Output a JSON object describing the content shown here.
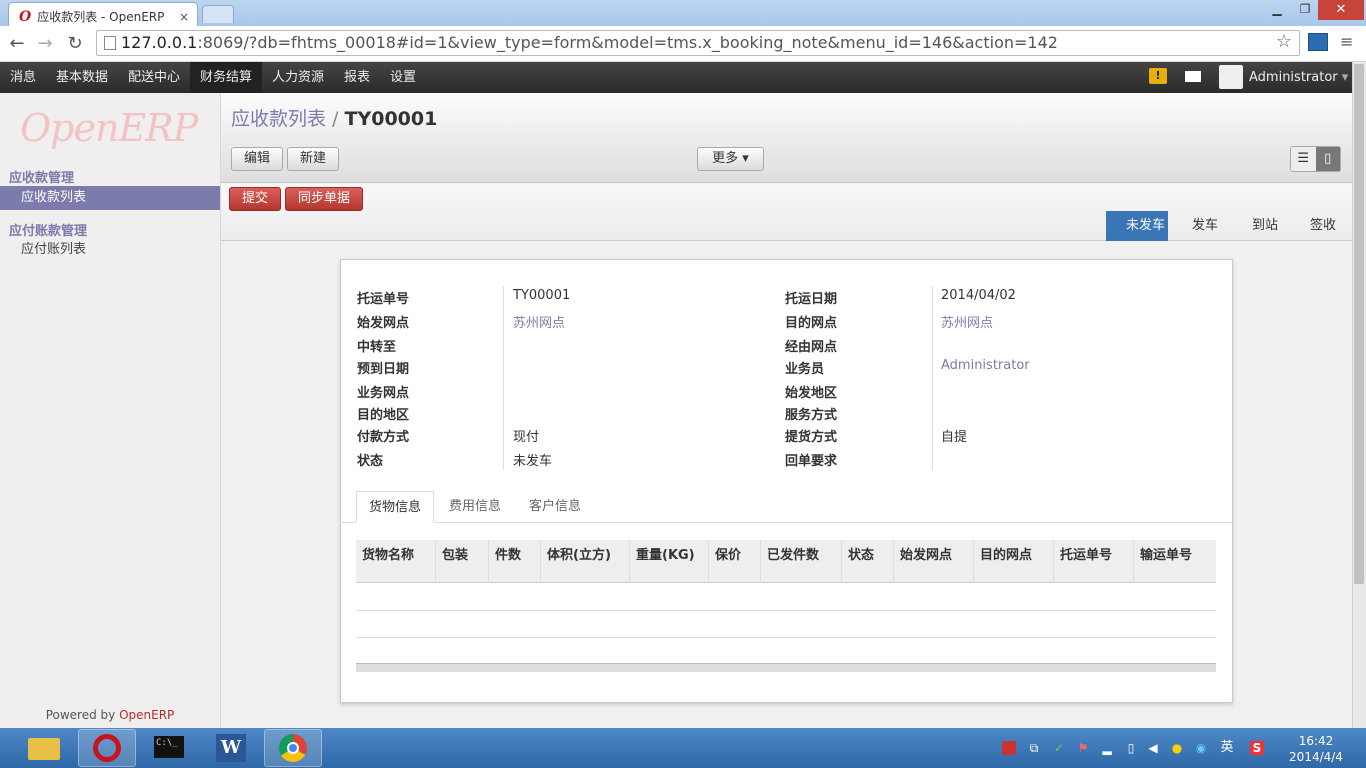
{
  "browser": {
    "tab_title": "应收款列表 - OpenERP",
    "tab_close": "×",
    "url_host": "127.0.0.1",
    "url_rest": ":8069/?db=fhtms_00018#id=1&view_type=form&model=tms.x_booking_note&menu_id=146&action=142",
    "min": "▁",
    "max": "❐",
    "close": "✕"
  },
  "topmenu": [
    "消息",
    "基本数据",
    "配送中心",
    "财务结算",
    "人力资源",
    "报表",
    "设置"
  ],
  "active_menu": "财务结算",
  "user": {
    "name": "Administrator",
    "caret": "▾",
    "warn": "!"
  },
  "sidebar": {
    "logo": "OpenERP",
    "sections": [
      {
        "title": "应收款管理",
        "items": [
          "应收款列表"
        ]
      },
      {
        "title": "应付账款管理",
        "items": [
          "应付账列表"
        ]
      }
    ],
    "powered_prefix": "Powered by ",
    "powered_brand": "OpenERP"
  },
  "breadcrumb": {
    "parent": "应收款列表",
    "sep": " / ",
    "current": "TY00001"
  },
  "buttons": {
    "edit": "编辑",
    "create": "新建",
    "more": "更多 ▾",
    "submit": "提交",
    "sync": "同步单据"
  },
  "view_switch": {
    "list": "☰",
    "form": "▯"
  },
  "stages": [
    "未发车",
    "发车",
    "到站",
    "签收"
  ],
  "active_stage": "未发车",
  "form": {
    "left": [
      {
        "label": "托运单号",
        "value": "TY00001"
      },
      {
        "label": "始发网点",
        "value": "苏州网点",
        "link": true
      },
      {
        "label": "中转至",
        "value": ""
      },
      {
        "label": "预到日期",
        "value": ""
      },
      {
        "label": "业务网点",
        "value": ""
      },
      {
        "label": "目的地区",
        "value": ""
      },
      {
        "label": "付款方式",
        "value": "现付"
      },
      {
        "label": "状态",
        "value": "未发车"
      }
    ],
    "right": [
      {
        "label": "托运日期",
        "value": "2014/04/02"
      },
      {
        "label": "目的网点",
        "value": "苏州网点",
        "link": true
      },
      {
        "label": "经由网点",
        "value": ""
      },
      {
        "label": "业务员",
        "value": "Administrator",
        "link": true
      },
      {
        "label": "始发地区",
        "value": ""
      },
      {
        "label": "服务方式",
        "value": ""
      },
      {
        "label": "提货方式",
        "value": "自提"
      },
      {
        "label": "回单要求",
        "value": ""
      }
    ]
  },
  "form_tabs": [
    "货物信息",
    "费用信息",
    "客户信息"
  ],
  "active_tab": "货物信息",
  "table_headers": [
    "货物名称",
    "包装",
    "件数",
    "体积(立方)",
    "重量(KG)",
    "保价",
    "已发件数",
    "状态",
    "始发网点",
    "目的网点",
    "托运单号",
    "输运单号"
  ],
  "taskbar": {
    "time": "16:42",
    "date": "2014/4/4",
    "ime": "英",
    "cmd": "C:\\_"
  }
}
